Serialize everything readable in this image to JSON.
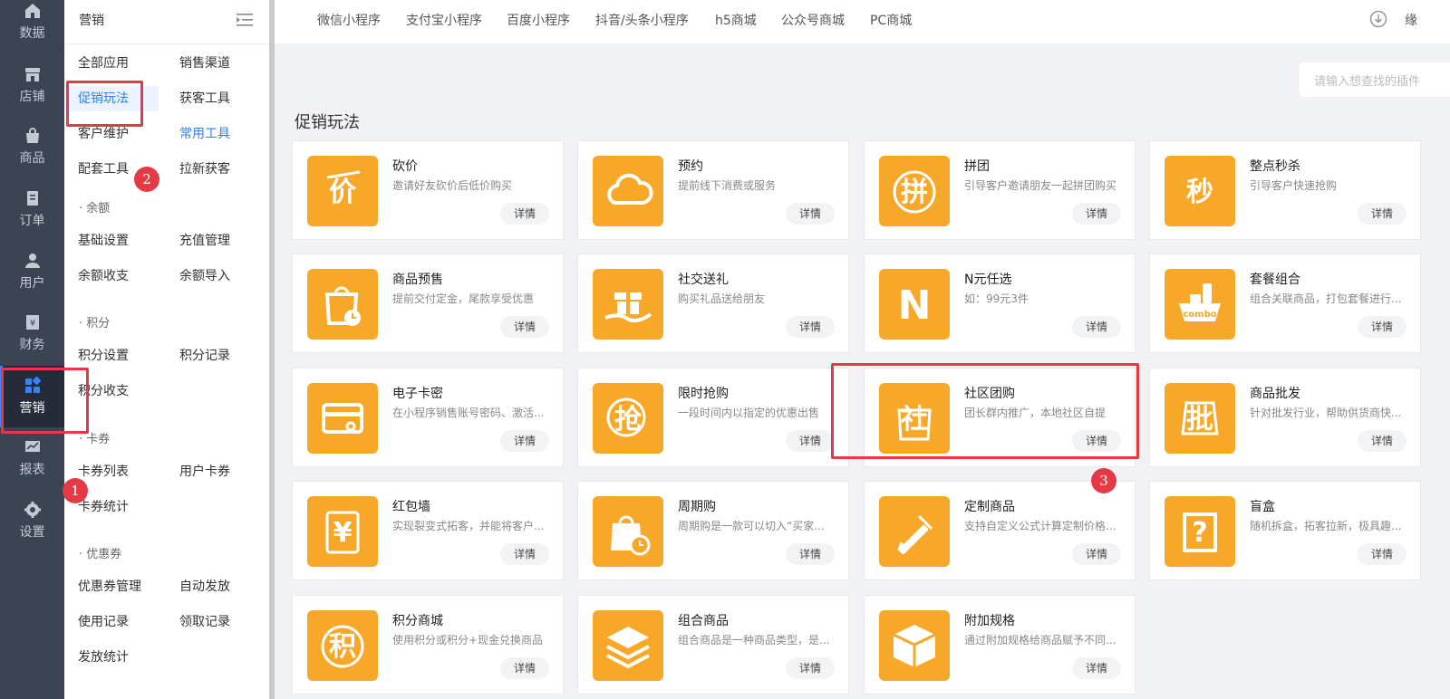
{
  "rail": [
    {
      "label": "数据",
      "icon": "home-icon"
    },
    {
      "label": "店铺",
      "icon": "store-icon"
    },
    {
      "label": "商品",
      "icon": "bag-icon"
    },
    {
      "label": "订单",
      "icon": "order-icon"
    },
    {
      "label": "用户",
      "icon": "user-icon"
    },
    {
      "label": "财务",
      "icon": "finance-icon"
    },
    {
      "label": "营销",
      "icon": "apps-icon",
      "active": true
    },
    {
      "label": "报表",
      "icon": "chart-icon"
    },
    {
      "label": "设置",
      "icon": "gear-icon"
    }
  ],
  "submenu": {
    "title": "营销",
    "rows": [
      [
        "全部应用",
        "销售渠道"
      ],
      [
        "促销玩法",
        "获客工具"
      ],
      [
        "客户维护",
        "常用工具"
      ],
      [
        "配套工具",
        "拉新获客"
      ]
    ],
    "sections": [
      {
        "label": "· 余额",
        "items": [
          [
            "基础设置",
            "充值管理"
          ],
          [
            "余额收支",
            "余额导入"
          ]
        ]
      },
      {
        "label": "· 积分",
        "items": [
          [
            "积分设置",
            "积分记录"
          ],
          [
            "积分收支",
            ""
          ]
        ]
      },
      {
        "label": "· 卡券",
        "items": [
          [
            "卡券列表",
            "用户卡券"
          ],
          [
            "卡券统计",
            ""
          ]
        ]
      },
      {
        "label": "· 优惠券",
        "items": [
          [
            "优惠券管理",
            "自动发放"
          ],
          [
            "使用记录",
            "领取记录"
          ],
          [
            "发放统计",
            ""
          ]
        ]
      }
    ]
  },
  "tabs": [
    "微信小程序",
    "支付宝小程序",
    "百度小程序",
    "抖音/头条小程序",
    "h5商城",
    "公众号商城",
    "PC商城"
  ],
  "topbar_cut": "缘",
  "search": {
    "placeholder": "请输入想查找的插件"
  },
  "section_title": "促销玩法",
  "detail_label": "详情",
  "cards": [
    {
      "name": "砍价",
      "desc": "邀请好友砍价后低价购买",
      "glyph": "价"
    },
    {
      "name": "预约",
      "desc": "提前线下消费或服务",
      "glyph": "cloud"
    },
    {
      "name": "拼团",
      "desc": "引导客户邀请朋友一起拼团购买",
      "glyph": "拼"
    },
    {
      "name": "整点秒杀",
      "desc": "引导客户快速抢购",
      "glyph": "秒"
    },
    {
      "name": "商品预售",
      "desc": "提前交付定金，尾款享受优惠",
      "glyph": "bagclock"
    },
    {
      "name": "社交送礼",
      "desc": "购买礼品送给朋友",
      "glyph": "gift"
    },
    {
      "name": "N元任选",
      "desc": "如：99元3件",
      "glyph": "N"
    },
    {
      "name": "套餐组合",
      "desc": "组合关联商品，打包套餐进行...",
      "glyph": "combo"
    },
    {
      "name": "电子卡密",
      "desc": "在小程序销售账号密码、激活...",
      "glyph": "card"
    },
    {
      "name": "限时抢购",
      "desc": "一段时间内以指定的优惠出售",
      "glyph": "抢"
    },
    {
      "name": "社区团购",
      "desc": "团长群内推广，本地社区自提",
      "glyph": "社"
    },
    {
      "name": "商品批发",
      "desc": "针对批发行业，帮助供货商快...",
      "glyph": "批"
    },
    {
      "name": "红包墙",
      "desc": "实现裂变式拓客，并能将客户...",
      "glyph": "¥"
    },
    {
      "name": "周期购",
      "desc": "周期购是一款可以切入“买家...",
      "glyph": "cycle"
    },
    {
      "name": "定制商品",
      "desc": "支持自定义公式计算定制价格...",
      "glyph": "pen"
    },
    {
      "name": "盲盒",
      "desc": "随机拆盒，拓客拉新，极具趣...",
      "glyph": "?"
    },
    {
      "name": "积分商城",
      "desc": "使用积分或积分+现金兑换商品",
      "glyph": "积"
    },
    {
      "name": "组合商品",
      "desc": "组合商品是一种商品类型，是...",
      "glyph": "layers"
    },
    {
      "name": "附加规格",
      "desc": "通过附加规格给商品赋予不同...",
      "glyph": "box"
    }
  ],
  "badges": [
    "1",
    "2",
    "3"
  ],
  "colors": {
    "accent": "#F8A828",
    "rail": "#3B4354",
    "highlight": "#E63946",
    "link": "#2F80ED"
  }
}
